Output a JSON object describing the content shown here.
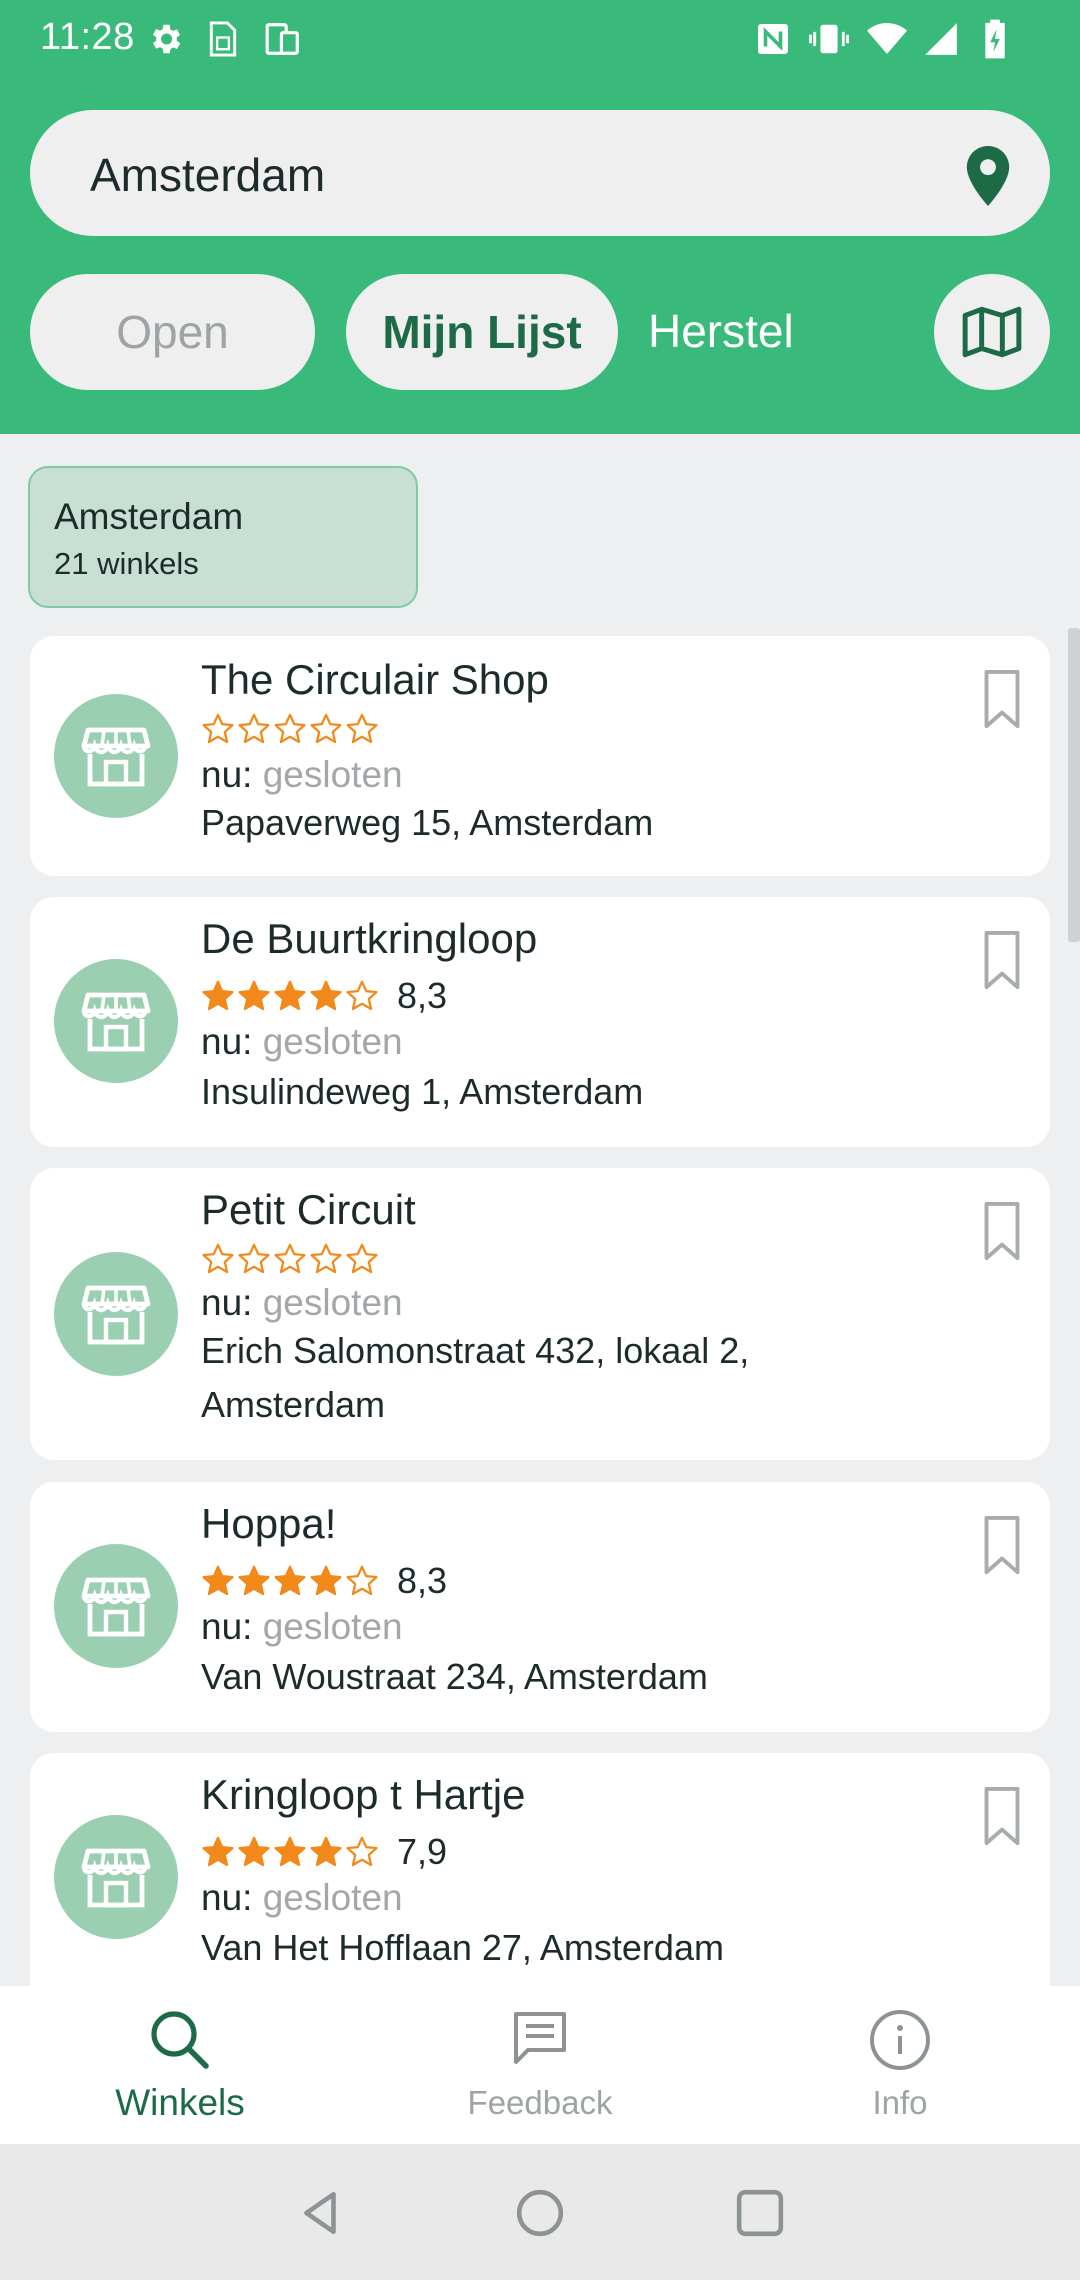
{
  "status_bar": {
    "time": "11:28"
  },
  "search": {
    "value": "Amsterdam"
  },
  "filters": {
    "open_label": "Open",
    "my_list_label": "Mijn Lijst",
    "reset_label": "Herstel"
  },
  "city": {
    "name": "Amsterdam",
    "count": "21 winkels"
  },
  "shops": [
    {
      "name": "The Circulair Shop",
      "stars": 0,
      "rating": "",
      "status_prefix": "nu:",
      "status": "gesloten",
      "address": "Papaverweg 15, Amsterdam"
    },
    {
      "name": "De Buurtkringloop",
      "stars": 4,
      "rating": "8,3",
      "status_prefix": "nu:",
      "status": "gesloten",
      "address": "Insulindeweg 1, Amsterdam"
    },
    {
      "name": "Petit Circuit",
      "stars": 0,
      "rating": "",
      "status_prefix": "nu:",
      "status": "gesloten",
      "address": "Erich Salomonstraat 432, lokaal 2, Amsterdam"
    },
    {
      "name": "Hoppa!",
      "stars": 4,
      "rating": "8,3",
      "status_prefix": "nu:",
      "status": "gesloten",
      "address": "Van Woustraat 234, Amsterdam"
    },
    {
      "name": "Kringloop t Hartje",
      "stars": 4,
      "rating": "7,9",
      "status_prefix": "nu:",
      "status": "gesloten",
      "address": "Van Het Hofflaan 27, Amsterdam"
    }
  ],
  "bottom_nav": [
    {
      "label": "Winkels",
      "icon": "search-icon",
      "active": true
    },
    {
      "label": "Feedback",
      "icon": "feedback-icon",
      "active": false
    },
    {
      "label": "Info",
      "icon": "info-icon",
      "active": false
    }
  ],
  "colors": {
    "primary": "#3aba7a",
    "dark_green": "#1d6a46",
    "star": "#f28a1b",
    "avatar": "#9bcfb2"
  }
}
